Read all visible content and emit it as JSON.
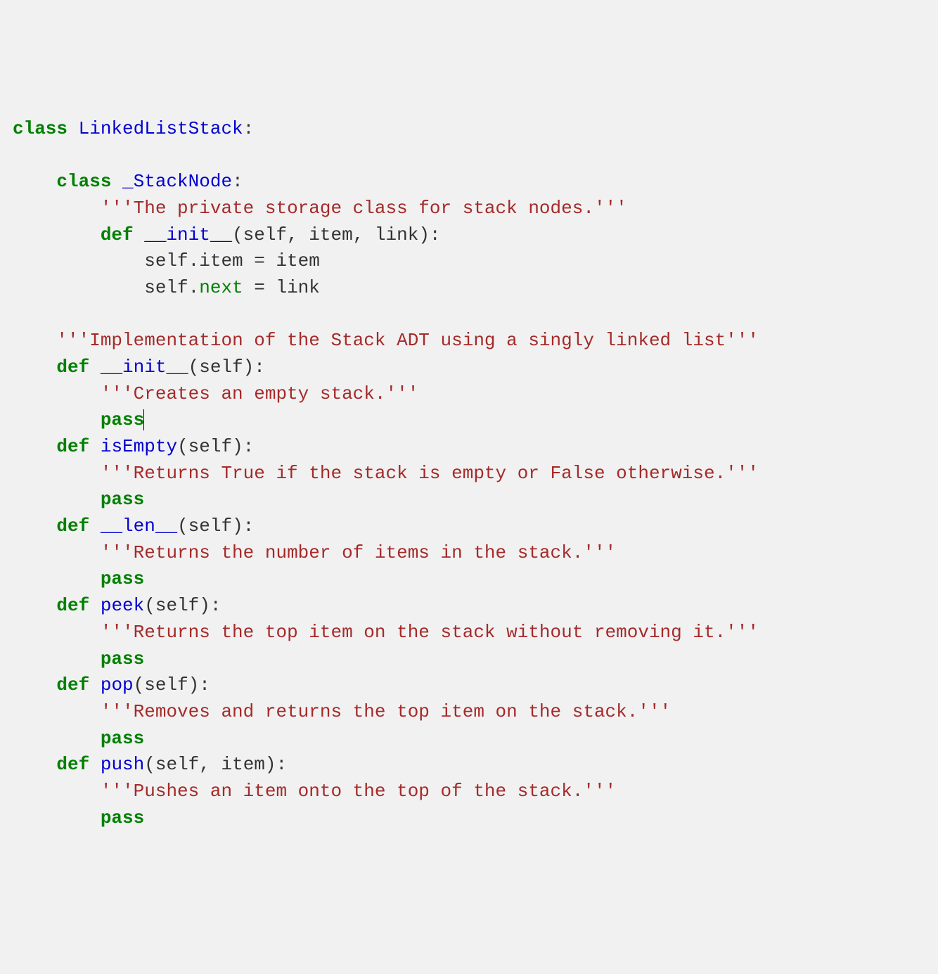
{
  "tokens": {
    "kw_class": "class",
    "kw_def": "def",
    "kw_pass": "pass",
    "name_LinkedListStack": "LinkedListStack",
    "name_StackNode": "_StackNode",
    "name_init": "__init__",
    "name_isEmpty": "isEmpty",
    "name_len": "__len__",
    "name_peek": "peek",
    "name_pop": "pop",
    "name_push": "push",
    "builtin_next": "next",
    "sig_self_item_link": "(self, item, link):",
    "sig_self": "(self):",
    "sig_self_item": "(self, item):",
    "line_self_item": "            self.item = item",
    "line_self_next_prefix": "            self.",
    "line_self_next_suffix": " = link",
    "doc_stacknode": "'''The private storage class for stack nodes.'''",
    "doc_impl": "'''Implementation of the Stack ADT using a singly linked list'''",
    "doc_init": "'''Creates an empty stack.'''",
    "doc_isEmpty": "'''Returns True if the stack is empty or False otherwise.'''",
    "doc_len": "'''Returns the number of items in the stack.'''",
    "doc_peek": "'''Returns the top item on the stack without removing it.'''",
    "doc_pop": "'''Removes and returns the top item on the stack.'''",
    "doc_push": "'''Pushes an item onto the top of the stack.'''"
  }
}
